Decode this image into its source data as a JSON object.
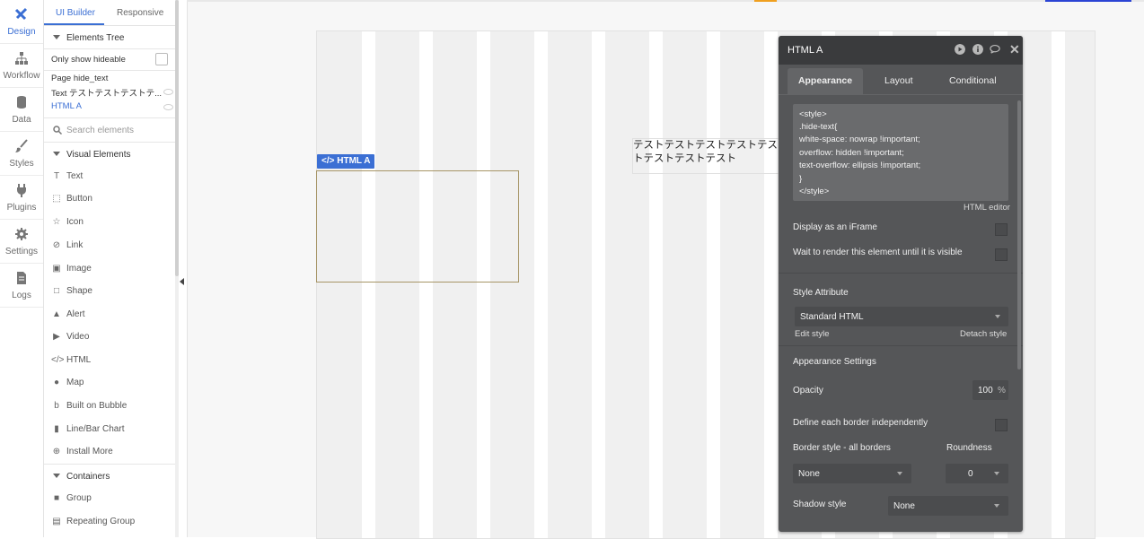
{
  "rail": {
    "items": [
      {
        "label": "Design",
        "icon": "design-icon",
        "active": true
      },
      {
        "label": "Workflow",
        "icon": "workflow-icon"
      },
      {
        "label": "Data",
        "icon": "database-icon"
      },
      {
        "label": "Styles",
        "icon": "brush-icon"
      },
      {
        "label": "Plugins",
        "icon": "plug-icon"
      },
      {
        "label": "Settings",
        "icon": "gear-icon"
      },
      {
        "label": "Logs",
        "icon": "document-icon"
      }
    ]
  },
  "panel": {
    "tabs": [
      "UI Builder",
      "Responsive"
    ],
    "elements_tree_label": "Elements Tree",
    "only_show_hideable": "Only show hideable",
    "tree": [
      "Page hide_text",
      "Text テストテストテストテ...",
      "HTML A"
    ],
    "search_placeholder": "Search elements",
    "visual_label": "Visual Elements",
    "visual_elements": [
      {
        "label": "Text",
        "icon": "text-icon"
      },
      {
        "label": "Button",
        "icon": "button-icon"
      },
      {
        "label": "Icon",
        "icon": "star-icon"
      },
      {
        "label": "Link",
        "icon": "link-icon"
      },
      {
        "label": "Image",
        "icon": "image-icon"
      },
      {
        "label": "Shape",
        "icon": "shape-icon"
      },
      {
        "label": "Alert",
        "icon": "alert-icon"
      },
      {
        "label": "Video",
        "icon": "video-icon"
      },
      {
        "label": "HTML",
        "icon": "code-icon"
      },
      {
        "label": "Map",
        "icon": "map-pin-icon"
      },
      {
        "label": "Built on Bubble",
        "icon": "bubble-icon"
      },
      {
        "label": "Line/Bar Chart",
        "icon": "chart-icon"
      },
      {
        "label": "Install More",
        "icon": "plus-circle-icon"
      }
    ],
    "containers_label": "Containers",
    "containers": [
      {
        "label": "Group",
        "icon": "group-icon"
      },
      {
        "label": "Repeating Group",
        "icon": "repeating-group-icon"
      }
    ]
  },
  "canvas": {
    "html_tag": "HTML A",
    "text_element_line1": "テストテストテストテストテスト",
    "text_element_line2": "トテストテストテスト"
  },
  "property_editor": {
    "title": "HTML A",
    "tabs": [
      "Appearance",
      "Layout",
      "Conditional"
    ],
    "code_lines": [
      "<style>",
      ".hide-text{",
      "white-space: nowrap !important;",
      "overflow: hidden !important;",
      "text-overflow: ellipsis !important;",
      "}",
      "</style>"
    ],
    "html_editor_caption": "HTML editor",
    "display_iframe": "Display as an iFrame",
    "wait_render": "Wait to render this element until it is visible",
    "style_attribute_label": "Style Attribute",
    "style_attribute_value": "Standard HTML",
    "edit_style": "Edit style",
    "detach_style": "Detach style",
    "appearance_settings": "Appearance Settings",
    "opacity_label": "Opacity",
    "opacity_value": "100",
    "opacity_unit": "%",
    "border_independent": "Define each border independently",
    "border_style_label": "Border style - all borders",
    "border_style_value": "None",
    "roundness_label": "Roundness",
    "roundness_value": "0",
    "shadow_label": "Shadow style",
    "shadow_value": "None"
  }
}
